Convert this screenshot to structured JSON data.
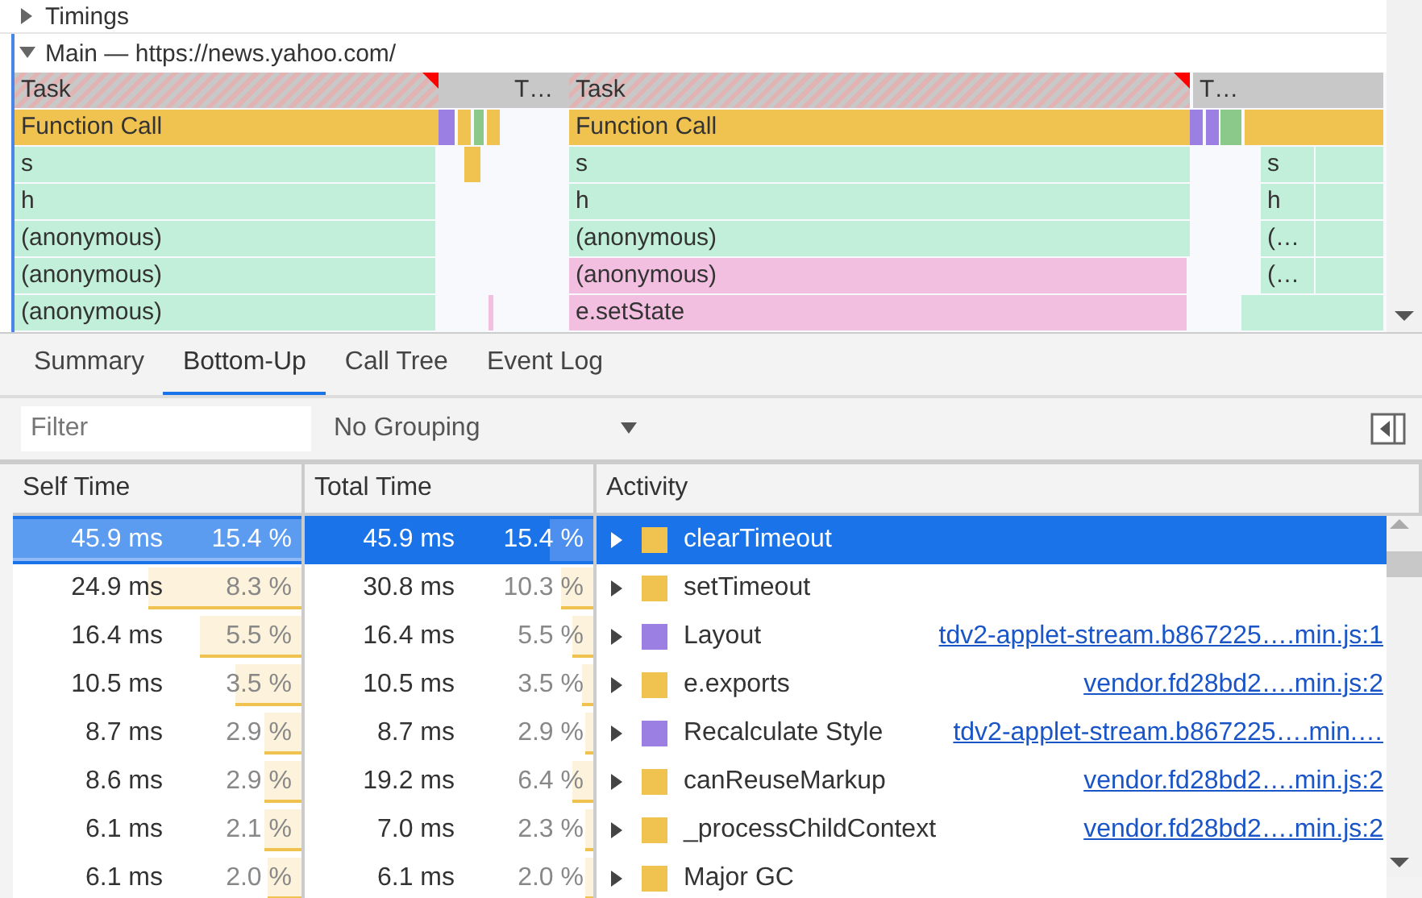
{
  "flame_chart": {
    "tracks": [
      {
        "title": "Timings",
        "expanded": false
      },
      {
        "title": "Main — https://news.yahoo.com/",
        "expanded": true
      }
    ],
    "rows": [
      {
        "blocks": [
          {
            "label": "Task",
            "kind": "long-task"
          },
          {
            "label": "T…",
            "kind": "task"
          },
          {
            "label": "Task",
            "kind": "long-task"
          },
          {
            "label": "T…",
            "kind": "task"
          }
        ]
      },
      {
        "blocks": [
          {
            "label": "Function Call",
            "kind": "call"
          },
          {
            "label": "Function Call",
            "kind": "call"
          }
        ]
      },
      {
        "blocks": [
          {
            "label": "s",
            "kind": "script"
          },
          {
            "label": "s",
            "kind": "script"
          },
          {
            "label": "s",
            "kind": "script"
          }
        ]
      },
      {
        "blocks": [
          {
            "label": "h",
            "kind": "script"
          },
          {
            "label": "h",
            "kind": "script"
          },
          {
            "label": "h",
            "kind": "script"
          }
        ]
      },
      {
        "blocks": [
          {
            "label": "(anonymous)",
            "kind": "script"
          },
          {
            "label": "(anonymous)",
            "kind": "script"
          },
          {
            "label": "(…",
            "kind": "script"
          }
        ]
      },
      {
        "blocks": [
          {
            "label": "(anonymous)",
            "kind": "script"
          },
          {
            "label": "(anonymous)",
            "kind": "library"
          },
          {
            "label": "(…",
            "kind": "script"
          }
        ]
      },
      {
        "blocks": [
          {
            "label": "(anonymous)",
            "kind": "script"
          },
          {
            "label": "e.setState",
            "kind": "library"
          }
        ]
      }
    ]
  },
  "tabs": [
    {
      "label": "Summary",
      "selected": false
    },
    {
      "label": "Bottom-Up",
      "selected": true
    },
    {
      "label": "Call Tree",
      "selected": false
    },
    {
      "label": "Event Log",
      "selected": false
    }
  ],
  "toolbar": {
    "filter": {
      "placeholder": "Filter"
    },
    "grouping": "No Grouping"
  },
  "table": {
    "columns": [
      "Self Time",
      "Total Time",
      "Activity"
    ],
    "rows": [
      {
        "selected": true,
        "expanded": false,
        "self_time": {
          "time": "45.9 ms",
          "percent": "15.4 %",
          "level": 1
        },
        "total_time": {
          "time": "45.9 ms",
          "percent": "15.4 %",
          "level": 0.15
        },
        "activity": "clearTimeout",
        "color": "#f0c350"
      },
      {
        "selected": false,
        "expanded": false,
        "self_time": {
          "time": "24.9 ms",
          "percent": "8.3 %",
          "level": 0.53
        },
        "total_time": {
          "time": "30.8 ms",
          "percent": "10.3 %",
          "level": 0.11
        },
        "activity": "setTimeout",
        "color": "#f0c350"
      },
      {
        "selected": false,
        "expanded": false,
        "self_time": {
          "time": "16.4 ms",
          "percent": "5.5 %",
          "level": 0.35
        },
        "total_time": {
          "time": "16.4 ms",
          "percent": "5.5 %",
          "level": 0.07
        },
        "activity": "Layout",
        "color": "#9b7fe3",
        "link": "tdv2-applet-stream.b867225….min.js:1"
      },
      {
        "selected": false,
        "expanded": false,
        "self_time": {
          "time": "10.5 ms",
          "percent": "3.5 %",
          "level": 0.23
        },
        "total_time": {
          "time": "10.5 ms",
          "percent": "3.5 %",
          "level": 0.04
        },
        "activity": "e.exports",
        "color": "#f0c350",
        "link": "vendor.fd28bd2….min.js:2"
      },
      {
        "selected": false,
        "expanded": false,
        "self_time": {
          "time": "8.7 ms",
          "percent": "2.9 %",
          "level": 0.13
        },
        "total_time": {
          "time": "8.7 ms",
          "percent": "2.9 %",
          "level": 0.03
        },
        "activity": "Recalculate Style",
        "color": "#9b7fe3",
        "link": "tdv2-applet-stream.b867225….min.…"
      },
      {
        "selected": false,
        "expanded": false,
        "self_time": {
          "time": "8.6 ms",
          "percent": "2.9 %",
          "level": 0.13
        },
        "total_time": {
          "time": "19.2 ms",
          "percent": "6.4 %",
          "level": 0.07
        },
        "activity": "canReuseMarkup",
        "color": "#f0c350",
        "link": "vendor.fd28bd2….min.js:2"
      },
      {
        "selected": false,
        "expanded": false,
        "self_time": {
          "time": "6.1 ms",
          "percent": "2.1 %",
          "level": 0.13
        },
        "total_time": {
          "time": "7.0 ms",
          "percent": "2.3 %",
          "level": 0.03
        },
        "activity": "_processChildContext",
        "color": "#f0c350",
        "link": "vendor.fd28bd2….min.js:2"
      },
      {
        "selected": false,
        "expanded": false,
        "self_time": {
          "time": "6.1 ms",
          "percent": "2.0 %",
          "level": 0.12
        },
        "total_time": {
          "time": "6.1 ms",
          "percent": "2.0 %",
          "level": 0.03
        },
        "activity": "Major GC",
        "color": "#f0c350"
      }
    ]
  }
}
